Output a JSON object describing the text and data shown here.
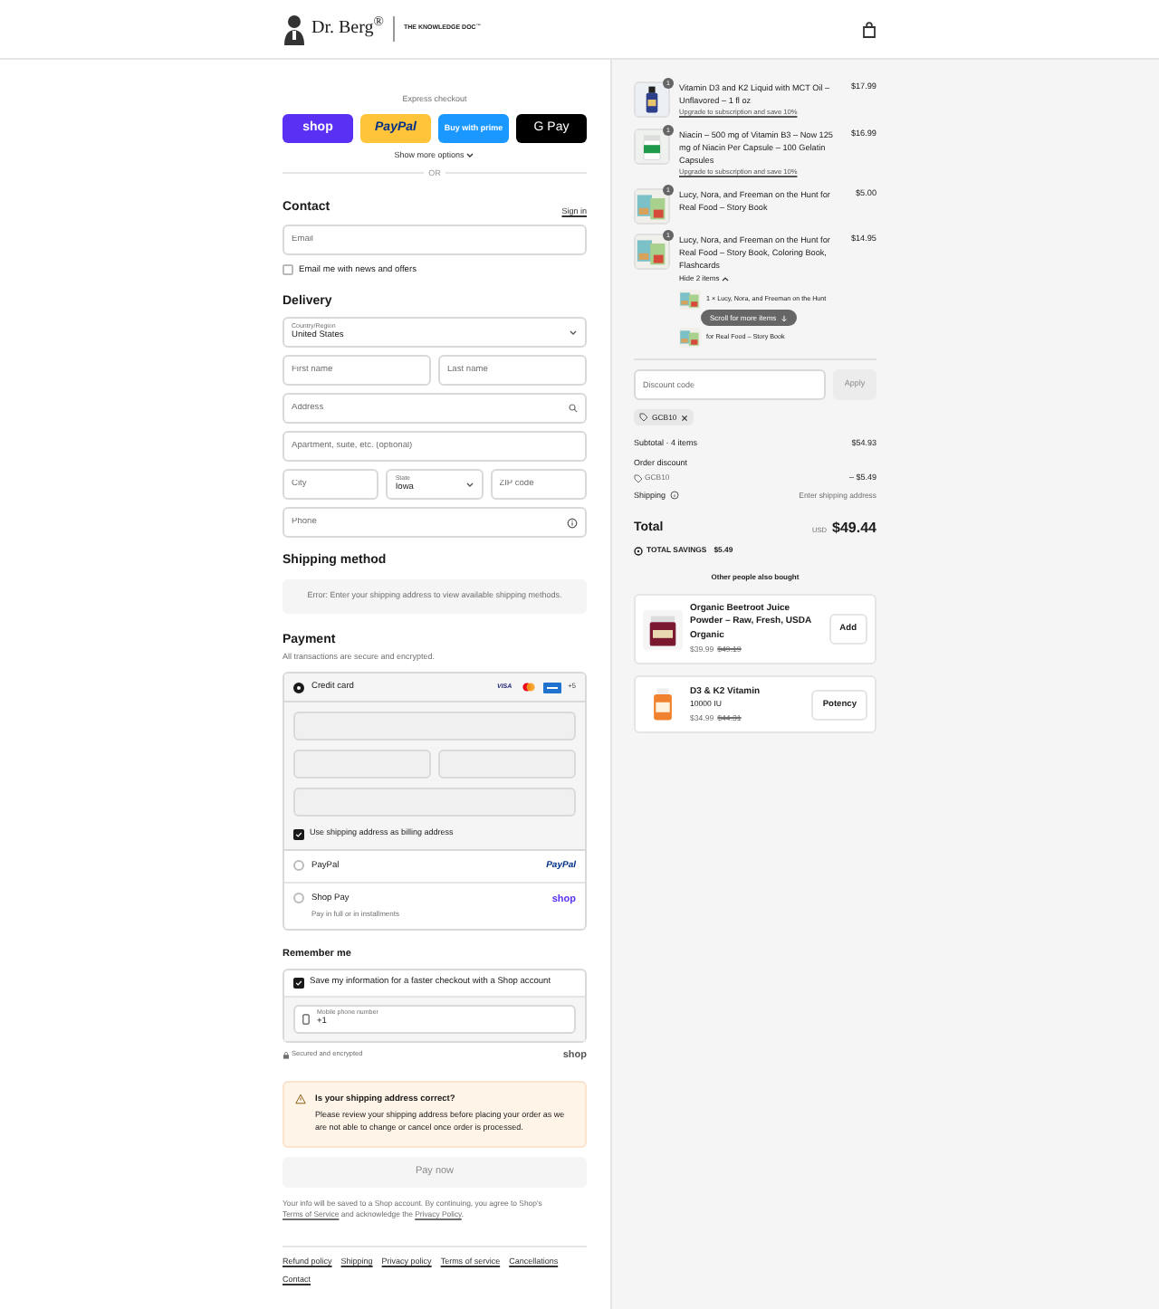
{
  "header": {
    "brand": "Dr. Berg$^{®}$",
    "tagline": "THE KNOWLEDGE DOC$^{™}$"
  },
  "express": {
    "label": "Express checkout",
    "buttons": [
      {
        "kind": "shop",
        "label": "shop"
      },
      {
        "kind": "paypal",
        "label": "PayPal"
      },
      {
        "kind": "prime",
        "label": "Buy with prime"
      },
      {
        "kind": "gpay",
        "label": "G Pay"
      }
    ],
    "more": "Show more options",
    "or": "OR"
  },
  "contact": {
    "heading": "Contact",
    "sign_in": "Sign in",
    "email": {
      "placeholder": "Email"
    },
    "newsletter": {
      "label": "Email me with news and offers",
      "checked": false
    }
  },
  "delivery": {
    "heading": "Delivery",
    "country": {
      "label": "Country/Region",
      "value": "United States"
    },
    "first_name": {
      "placeholder": "First name"
    },
    "last_name": {
      "placeholder": "Last name"
    },
    "address": {
      "placeholder": "Address"
    },
    "apartment": {
      "placeholder": "Apartment, suite, etc. (optional)"
    },
    "city": {
      "placeholder": "City"
    },
    "state": {
      "label": "State",
      "value": "Iowa"
    },
    "zip": {
      "placeholder": "ZIP code"
    },
    "phone": {
      "placeholder": "Phone"
    }
  },
  "shipping_method": {
    "heading": "Shipping method",
    "message": "Error: Enter your shipping address to view available shipping methods."
  },
  "payment": {
    "heading": "Payment",
    "subtitle": "All transactions are secure and encrypted.",
    "methods": [
      {
        "kind": "card",
        "label": "Credit card",
        "selected": true,
        "brands": [
          {
            "kind": "visa",
            "label": "VISA"
          },
          {
            "kind": "mastercard"
          },
          {
            "kind": "amex"
          }
        ],
        "more": "+5"
      },
      {
        "kind": "paypal",
        "label": "PayPal",
        "selected": false,
        "logo": "PayPal"
      },
      {
        "kind": "shop",
        "label": "Shop Pay",
        "sublabel": "Pay in full or in installments",
        "selected": false,
        "logo": "shop"
      }
    ],
    "billing_same": {
      "label": "Use shipping address as billing address",
      "checked": true
    }
  },
  "remember": {
    "heading": "Remember me",
    "save": {
      "label": "Save my information for a faster checkout with a Shop account",
      "checked": true
    },
    "mobile": {
      "label": "Mobile phone number",
      "value": "+1"
    },
    "secure": "Secured and encrypted",
    "logo": "shop"
  },
  "alert": {
    "title": "Is your shipping address correct?",
    "body": "Please review your shipping address before placing your order as we are not able to change or cancel once order is processed."
  },
  "pay_button": {
    "label": "Pay now",
    "disabled": true
  },
  "consent": [
    {
      "text": "Your info will be saved to a Shop account. By continuing, you agree to Shop's "
    },
    {
      "link": "Terms of Service"
    },
    {
      "text": " and acknowledge the "
    },
    {
      "link": "Privacy Policy"
    },
    {
      "text": "."
    }
  ],
  "footer_links": [
    "Refund policy",
    "Shipping",
    "Privacy policy",
    "Terms of service",
    "Cancellations",
    "Contact"
  ],
  "cart": {
    "items": [
      {
        "kind": "dropper",
        "name": "Vitamin D3 and K2 Liquid with MCT Oil – Unflavored – 1 fl oz",
        "price": "$17.99",
        "quantity": "1",
        "upgrade": "Upgrade to subscription and save 10%"
      },
      {
        "kind": "jar",
        "name": "Niacin – 500 mg of Vitamin B3 – Now 125 mg of Niacin Per Capsule – 100 Gelatin Capsules",
        "price": "$16.99",
        "quantity": "1",
        "upgrade": "Upgrade to subscription and save 10%"
      },
      {
        "kind": "book",
        "name": "Lucy, Nora, and Freeman on the Hunt for Real Food – Story Book",
        "price": "$5.00",
        "quantity": "1"
      },
      {
        "kind": "book",
        "name": "Lucy, Nora, and Freeman on the Hunt for Real Food – Story Book, Coloring Book, Flashcards",
        "price": "$14.95",
        "quantity": "1",
        "toggle": "Hide 2 items",
        "expanded": true,
        "bundle": [
          "1 × Lucy, Nora, and Freeman on the Hunt",
          "for Real Food – Story Book"
        ],
        "scroll_hint": "Scroll for more items"
      }
    ],
    "discount": {
      "placeholder": "Discount code",
      "apply": "Apply",
      "code": "GCB10"
    },
    "summary": {
      "subtotal_label": "Subtotal · 4 items",
      "subtotal": "$54.93",
      "discount_label": "Order discount",
      "discount_code": "GCB10",
      "discount_amount": "– $5.49",
      "shipping_label": "Shipping",
      "shipping_value": "Enter shipping address",
      "total_label": "Total",
      "currency": "USD",
      "total": "$49.44",
      "savings_label": "TOTAL SAVINGS",
      "savings": "$5.49"
    },
    "upsell": {
      "heading": "Other people also bought",
      "products": [
        {
          "kind": "tub",
          "name": "Organic Beetroot Juice Powder – Raw, Fresh, USDA Organic",
          "price": "$39.99",
          "compare": "$49.19",
          "button": "Add"
        },
        {
          "kind": "bottle",
          "name": "D3 & K2 Vitamin",
          "variant": "10000 IU",
          "price": "$34.99",
          "compare": "$44.31",
          "button": "Potency"
        }
      ]
    }
  }
}
